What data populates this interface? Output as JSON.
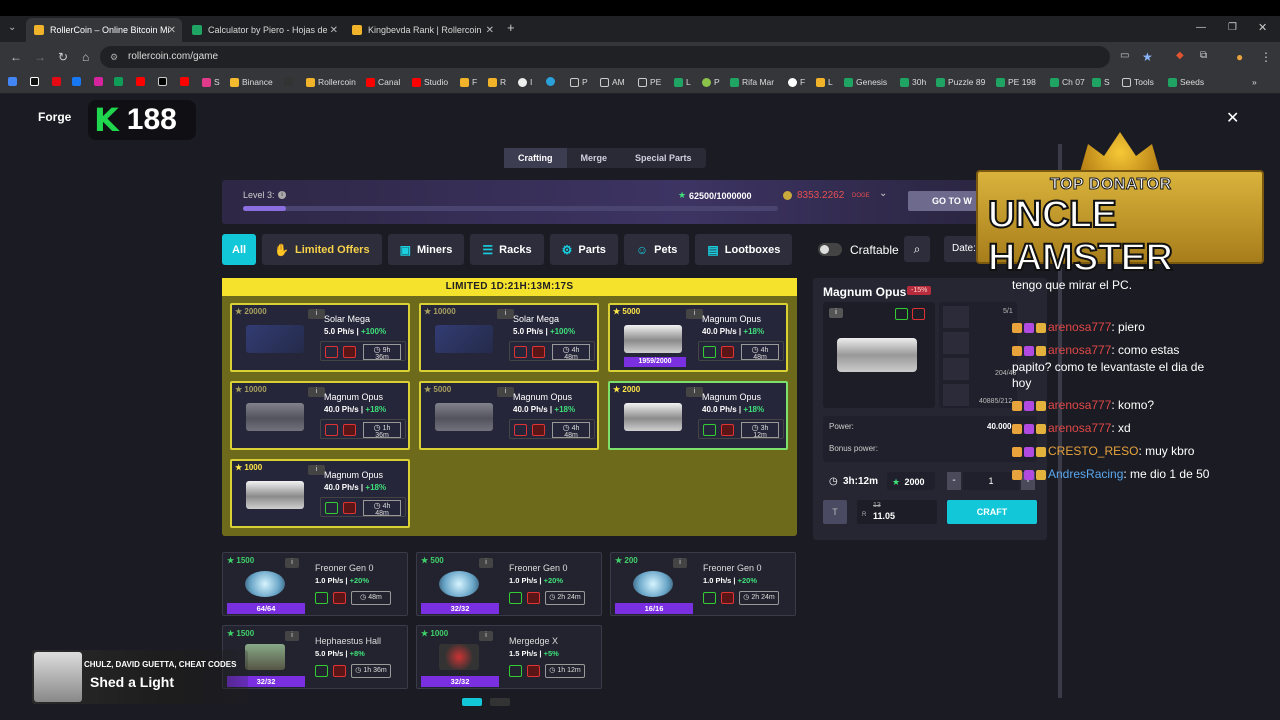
{
  "browser": {
    "tabs": [
      {
        "title": "RollerCoin – Online Bitcoin Mi",
        "active": true
      },
      {
        "title": "Calculator by Piero - Hojas de",
        "active": false
      },
      {
        "title": "Kingbevda Rank | Rollercoin",
        "active": false
      }
    ],
    "new_tab": "+",
    "url": "rollercoin.com/game",
    "bookmarks": [
      "S",
      "Binance",
      "Rollercoin",
      "Canal",
      "Studio",
      "F",
      "R",
      "I",
      "P",
      "AM",
      "PE",
      "L",
      "P",
      "Rifa Mar",
      "F",
      "L",
      "Genesis",
      "30h",
      "Puzzle 89",
      "PE 198",
      "Ch 07",
      "S",
      "Tools",
      "Seeds"
    ]
  },
  "header": {
    "title": "Forge",
    "logo_letter": "K",
    "rank_number": "188",
    "close": "✕"
  },
  "tabs": [
    "Crafting",
    "Merge",
    "Special Parts"
  ],
  "level": {
    "label": "Level 3:",
    "progress": 0.08,
    "xp": "62500/1000000",
    "balance": "8353.2262",
    "currency": "DOGE",
    "go_button": "GO TO W"
  },
  "filters": [
    "All",
    "Limited Offers",
    "Miners",
    "Racks",
    "Parts",
    "Pets",
    "Lootboxes"
  ],
  "craftable_label": "Craftable",
  "date_label": "Date:",
  "limited": {
    "timer": "LIMITED 1D:21H:13M:17S",
    "cards": [
      {
        "price": "20000",
        "name": "Solar Mega",
        "power": "5.0 Ph/s |",
        "bonus": "+100%",
        "time1": "9h",
        "time2": "36m",
        "dim": true,
        "progress": ""
      },
      {
        "price": "10000",
        "name": "Solar Mega",
        "power": "5.0 Ph/s |",
        "bonus": "+100%",
        "time1": "4h",
        "time2": "48m",
        "dim": true,
        "progress": ""
      },
      {
        "price": "5000",
        "name": "Magnum Opus",
        "power": "40.0 Ph/s |",
        "bonus": "+18%",
        "time1": "4h",
        "time2": "48m",
        "dim": false,
        "progress": "1959/2000"
      },
      {
        "price": "10000",
        "name": "Magnum Opus",
        "power": "40.0 Ph/s |",
        "bonus": "+18%",
        "time1": "1h",
        "time2": "36m",
        "dim": true,
        "progress": ""
      },
      {
        "price": "5000",
        "name": "Magnum Opus",
        "power": "40.0 Ph/s |",
        "bonus": "+18%",
        "time1": "4h",
        "time2": "48m",
        "dim": true,
        "progress": ""
      },
      {
        "price": "2000",
        "name": "Magnum Opus",
        "power": "40.0 Ph/s |",
        "bonus": "+18%",
        "time1": "3h",
        "time2": "12m",
        "dim": false,
        "progress": ""
      },
      {
        "price": "1000",
        "name": "Magnum Opus",
        "power": "40.0 Ph/s |",
        "bonus": "+18%",
        "time1": "4h",
        "time2": "48m",
        "dim": false,
        "progress": ""
      }
    ]
  },
  "items": [
    {
      "price": "1500",
      "name": "Freoner Gen 0",
      "power": "1.0 Ph/s |",
      "bonus": "+20%",
      "time": "48m",
      "count": "64/64"
    },
    {
      "price": "500",
      "name": "Freoner Gen 0",
      "power": "1.0 Ph/s |",
      "bonus": "+20%",
      "time": "2h 24m",
      "count": "32/32"
    },
    {
      "price": "200",
      "name": "Freoner Gen 0",
      "power": "1.0 Ph/s |",
      "bonus": "+20%",
      "time": "2h 24m",
      "count": "16/16"
    },
    {
      "price": "1500",
      "name": "Hephaestus Hall",
      "power": "5.0 Ph/s |",
      "bonus": "+8%",
      "time": "1h 36m",
      "count": "32/32"
    },
    {
      "price": "1000",
      "name": "Mergedge X",
      "power": "1.5 Ph/s |",
      "bonus": "+5%",
      "time": "1h 12m",
      "count": "32/32"
    }
  ],
  "detail": {
    "title": "Magnum Opus",
    "discount": "-15%",
    "parts": [
      "5/1",
      "204/43",
      "40885/212"
    ],
    "power_label": "Power:",
    "power_value": "40.000",
    "bonus_label": "Bonus power:",
    "time": "3h:12m",
    "stars": "2000",
    "qty": "1",
    "minus": "-",
    "plus": "+",
    "old_price": "13",
    "price": "11.05",
    "craft_button": "CRAFT"
  },
  "chat": [
    {
      "user": "",
      "text": "tengo que mirar el PC."
    },
    {
      "user": "arenosa777",
      "text": ": piero"
    },
    {
      "user": "arenosa777",
      "text": ": como estas"
    },
    {
      "user": "",
      "text": "papito? como te levantaste el dia de"
    },
    {
      "user": "",
      "text": "hoy"
    },
    {
      "user": "arenosa777",
      "text": ": komo?"
    },
    {
      "user": "arenosa777",
      "text": ": xd"
    },
    {
      "user": "CRESTO_RESO",
      "text": ": muy kbro"
    },
    {
      "user": "AndresRacing",
      "text": ": me dio 1 de 50"
    }
  ],
  "banner": {
    "line1": "TOP DONATOR",
    "line2": "UNCLE HAMSTER"
  },
  "now_playing": {
    "artist": "CHULZ, DAVID GUETTA, CHEAT CODES",
    "song": "Shed a Light"
  },
  "colors": {
    "accent": "#12c8d8",
    "limited": "#f5e22c",
    "progress": "#7a2fe0",
    "green": "#3fe07a"
  }
}
